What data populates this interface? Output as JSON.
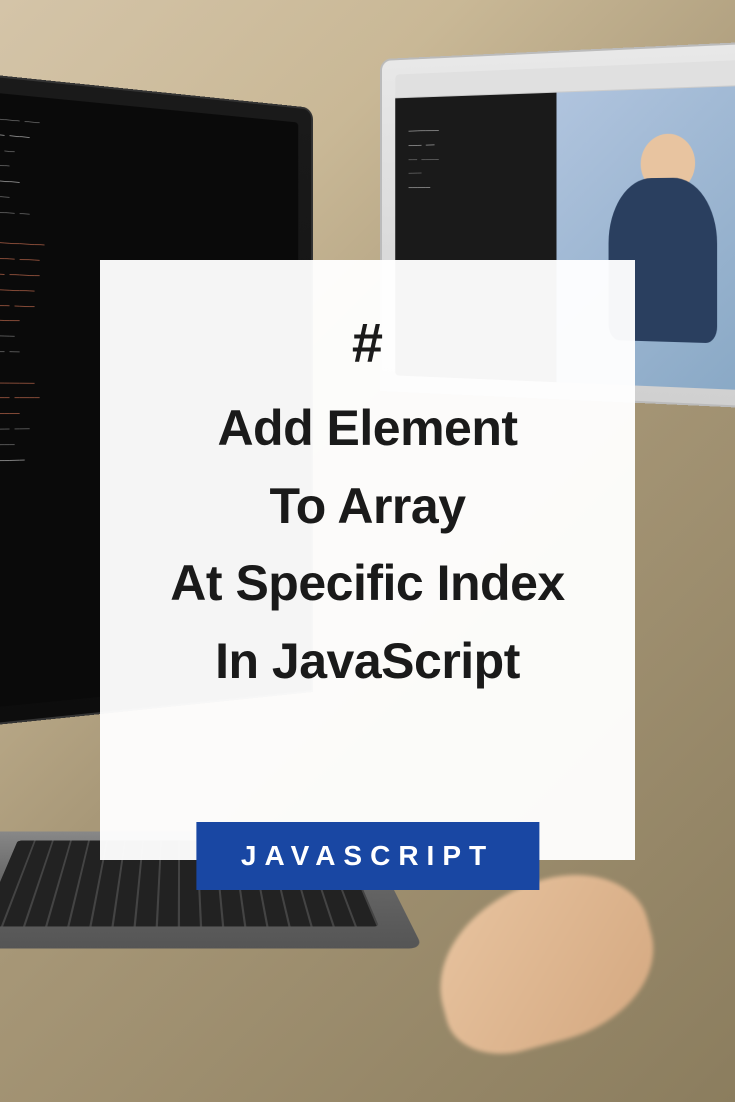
{
  "card": {
    "hash": "#",
    "title_line1": "Add Element",
    "title_line2": "To Array",
    "title_line3": "At Specific Index",
    "title_line4": "In JavaScript"
  },
  "badge": {
    "label": "JAVASCRIPT"
  },
  "colors": {
    "badge_bg": "#1947a3",
    "badge_text": "#ffffff",
    "card_bg": "rgba(255,255,255,0.96)",
    "title_color": "#1a1a1a"
  }
}
